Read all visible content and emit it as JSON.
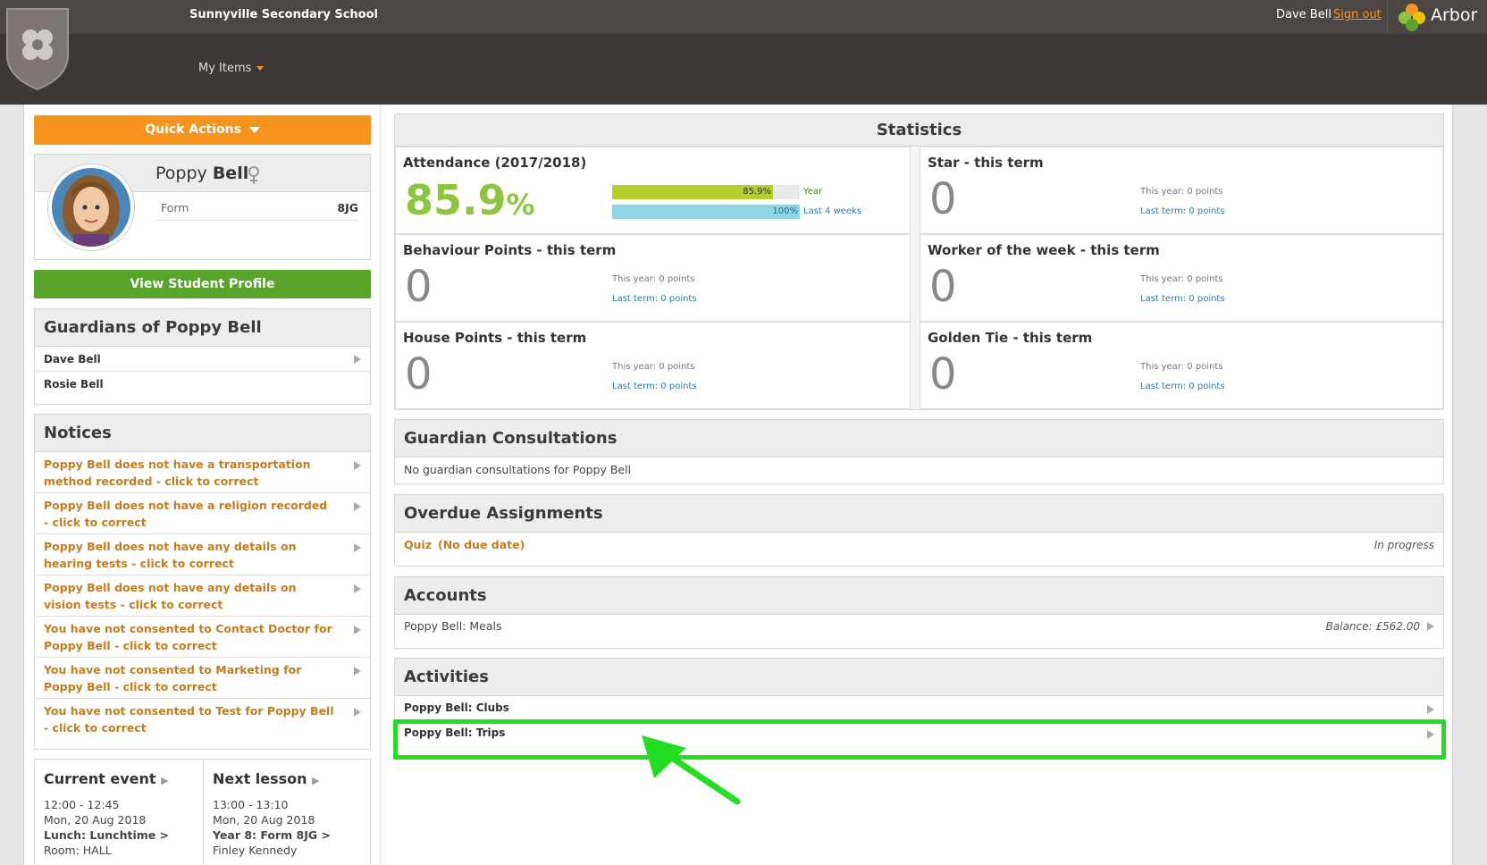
{
  "header": {
    "school_name": "Sunnyville Secondary School",
    "my_items": "My Items",
    "user_name": "Dave Bell",
    "sign_out": "Sign out",
    "brand": "Arbor"
  },
  "quick_actions": "Quick Actions",
  "student": {
    "first_name": "Poppy",
    "last_name": "Bell",
    "form_label": "Form",
    "form_value": "8JG",
    "view_profile": "View Student Profile"
  },
  "guardians": {
    "title": "Guardians of Poppy Bell",
    "items": [
      "Dave Bell",
      "Rosie Bell"
    ]
  },
  "notices": {
    "title": "Notices",
    "items": [
      "Poppy Bell does not have a transportation method recorded - click to correct",
      "Poppy Bell does not have a religion recorded - click to correct",
      "Poppy Bell does not have any details on hearing tests - click to correct",
      "Poppy Bell does not have any details on vision tests - click to correct",
      "You have not consented to Contact Doctor for Poppy Bell - click to correct",
      "You have not consented to Marketing for Poppy Bell - click to correct",
      "You have not consented to Test for Poppy Bell - click to correct"
    ]
  },
  "current_event": {
    "title": "Current event",
    "time": "12:00 - 12:45",
    "date": "Mon, 20 Aug 2018",
    "name": "Lunch: Lunchtime",
    "room": "Room: HALL"
  },
  "next_lesson": {
    "title": "Next lesson",
    "time": "13:00 - 13:10",
    "date": "Mon, 20 Aug 2018",
    "name": "Year 8: Form 8JG",
    "teacher": "Finley Kennedy"
  },
  "statistics": {
    "title": "Statistics",
    "attendance": {
      "title": "Attendance (2017/2018)",
      "value": "85.9",
      "unit": "%",
      "year_label": "85.9%",
      "year_text": "Year",
      "year_fraction": 0.859,
      "weeks_label": "100%",
      "weeks_text": "Last 4 weeks",
      "weeks_fraction": 1.0
    },
    "cells": [
      {
        "title": "Star - this term",
        "value": "0",
        "this_year": "This year: 0 points",
        "last_term": "Last term: 0 points"
      },
      {
        "title": "Behaviour Points - this term",
        "value": "0",
        "this_year": "This year: 0 points",
        "last_term": "Last term: 0 points"
      },
      {
        "title": "Worker of the week - this term",
        "value": "0",
        "this_year": "This year: 0 points",
        "last_term": "Last term: 0 points"
      },
      {
        "title": "House Points - this term",
        "value": "0",
        "this_year": "This year: 0 points",
        "last_term": "Last term: 0 points"
      },
      {
        "title": "Golden Tie - this term",
        "value": "0",
        "this_year": "This year: 0 points",
        "last_term": "Last term: 0 points"
      }
    ]
  },
  "guardian_consultations": {
    "title": "Guardian Consultations",
    "empty": "No guardian consultations for Poppy Bell"
  },
  "overdue_assignments": {
    "title": "Overdue Assignments",
    "item_name": "Quiz",
    "item_due": "(No due date)",
    "item_status": "In progress"
  },
  "accounts": {
    "title": "Accounts",
    "item": "Poppy Bell: Meals",
    "balance": "Balance: £562.00"
  },
  "activities": {
    "title": "Activities",
    "items": [
      "Poppy Bell: Clubs",
      "Poppy Bell: Trips"
    ]
  },
  "colors": {
    "accent_orange": "#f7941d",
    "green": "#59a52c",
    "highlight": "#22dd22",
    "attendance_green": "#8cc63f",
    "bar_blue": "#8ed6e6"
  }
}
